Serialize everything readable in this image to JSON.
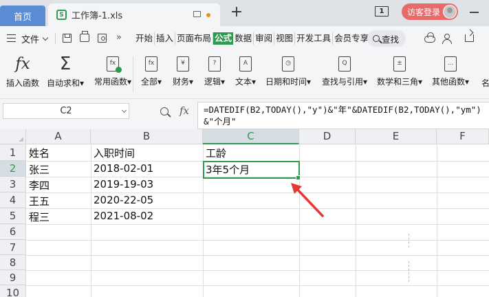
{
  "tabs": {
    "home": "首页",
    "document": "工作簿-1.xls",
    "add": "+"
  },
  "window": {
    "page_indicator": "1",
    "login_button": "访客登录"
  },
  "menu": {
    "file": "文件",
    "more": "»",
    "tabs": [
      "开始",
      "插入",
      "页面布局",
      "公式",
      "数据",
      "审阅",
      "视图",
      "开发工具",
      "会员专享"
    ],
    "active_tab": "公式",
    "search": "查找"
  },
  "ribbon": {
    "items": [
      {
        "label": "插入函数",
        "icon": "fx-icon"
      },
      {
        "label": "自动求和",
        "icon": "sigma-icon",
        "dropdown": true
      },
      {
        "label": "常用函数",
        "icon": "star-function-icon",
        "dropdown": true
      },
      {
        "label": "全部",
        "icon": "all-functions-icon",
        "dropdown": true
      },
      {
        "label": "财务",
        "icon": "finance-icon",
        "dropdown": true
      },
      {
        "label": "逻辑",
        "icon": "logic-icon",
        "dropdown": true
      },
      {
        "label": "文本",
        "icon": "text-icon",
        "dropdown": true
      },
      {
        "label": "日期和时间",
        "icon": "clock-icon",
        "dropdown": true
      },
      {
        "label": "查找与引用",
        "icon": "lookup-icon",
        "dropdown": true
      },
      {
        "label": "数学和三角",
        "icon": "math-icon",
        "dropdown": true
      },
      {
        "label": "其他函数",
        "icon": "other-functions-icon",
        "dropdown": true
      },
      {
        "label": "名",
        "icon": "name-manager-icon"
      }
    ],
    "dropdown_mark": "▾",
    "icon_glyphs": [
      "fx",
      "Σ",
      "fx",
      "fx",
      "¥",
      "?",
      "A",
      "◷",
      "Q",
      "±",
      "...",
      ""
    ]
  },
  "formula_bar": {
    "name_box": "C2",
    "fx_label": "fx",
    "formula": "=DATEDIF(B2,TODAY(),\"y\")&\"年\"&DATEDIF(B2,TODAY(),\"ym\")&\"个月\""
  },
  "sheet": {
    "columns": [
      "A",
      "B",
      "C",
      "D",
      "E",
      "F"
    ],
    "selected_column": "C",
    "rows": [
      "1",
      "2",
      "3",
      "4",
      "5",
      "6",
      "7",
      "8",
      "9",
      "10"
    ],
    "selected_row": "2",
    "selected_cell": "C2",
    "cells": [
      [
        "姓名",
        "入职时间",
        "工龄"
      ],
      [
        "张三",
        "2018-02-01",
        "3年5个月"
      ],
      [
        "李四",
        "2019-19-03",
        ""
      ],
      [
        "王五",
        "2020-22-05",
        ""
      ],
      [
        "程三",
        "2021-08-02",
        ""
      ]
    ]
  },
  "colors": {
    "accent": "#2e9a4f",
    "home_tab": "#5b8bd4",
    "login": "#e86a6a",
    "annotation_arrow": "#e53935"
  }
}
